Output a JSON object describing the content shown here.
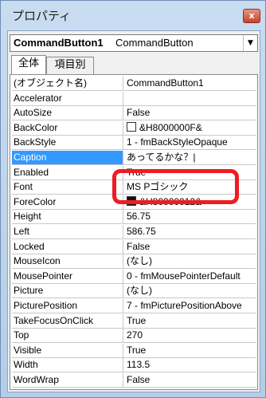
{
  "window": {
    "title": "プロパティ",
    "close_label": "x"
  },
  "object_selector": {
    "name": "CommandButton1",
    "type": "CommandButton"
  },
  "tabs": [
    {
      "label": "全体",
      "active": true
    },
    {
      "label": "項目別",
      "active": false
    }
  ],
  "properties": [
    {
      "name": "(オブジェクト名)",
      "value": "CommandButton1"
    },
    {
      "name": "Accelerator",
      "value": ""
    },
    {
      "name": "AutoSize",
      "value": "False"
    },
    {
      "name": "BackColor",
      "value": "&H8000000F&",
      "swatch": "#ffffff"
    },
    {
      "name": "BackStyle",
      "value": "1 - fmBackStyleOpaque"
    },
    {
      "name": "Caption",
      "value": "あってるかな？|",
      "selected": true
    },
    {
      "name": "Enabled",
      "value": "True"
    },
    {
      "name": "Font",
      "value": "MS Pゴシック"
    },
    {
      "name": "ForeColor",
      "value": "&H80000012&",
      "swatch": "#111111"
    },
    {
      "name": "Height",
      "value": "56.75"
    },
    {
      "name": "Left",
      "value": "586.75"
    },
    {
      "name": "Locked",
      "value": "False"
    },
    {
      "name": "MouseIcon",
      "value": "(なし)"
    },
    {
      "name": "MousePointer",
      "value": "0 - fmMousePointerDefault"
    },
    {
      "name": "Picture",
      "value": "(なし)"
    },
    {
      "name": "PicturePosition",
      "value": "7 - fmPicturePositionAbove"
    },
    {
      "name": "TakeFocusOnClick",
      "value": "True"
    },
    {
      "name": "Top",
      "value": "270"
    },
    {
      "name": "Visible",
      "value": "True"
    },
    {
      "name": "Width",
      "value": "113.5"
    },
    {
      "name": "WordWrap",
      "value": "False"
    }
  ],
  "colors": {
    "selection": "#3399ff",
    "annotation": "#ee1c24"
  }
}
